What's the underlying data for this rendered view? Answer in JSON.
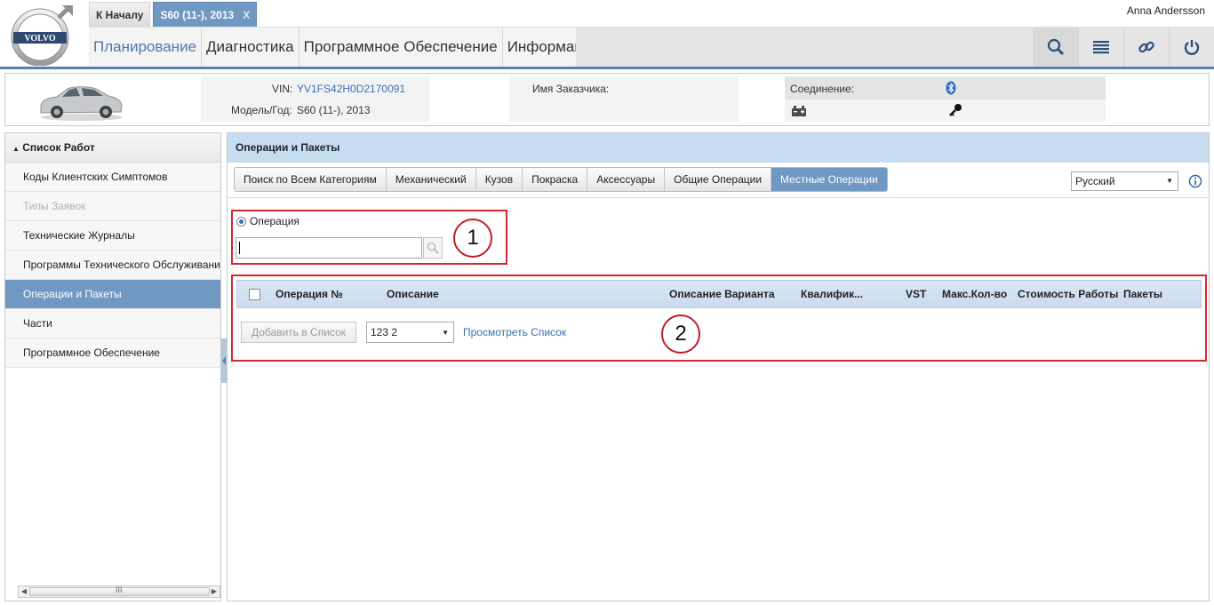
{
  "header": {
    "logo_text": "VOLVO",
    "user": "Anna Andersson",
    "tabs": [
      {
        "label": "К Началу"
      },
      {
        "label": "S60 (11-), 2013",
        "close": "X"
      }
    ],
    "nav": [
      {
        "label": "Планирование"
      },
      {
        "label": "Диагностика"
      },
      {
        "label": "Программное Обеспечение"
      },
      {
        "label": "Информация"
      }
    ],
    "icons": [
      "search-icon",
      "list-icon",
      "link-icon",
      "power-icon"
    ]
  },
  "vehicle": {
    "vin_label": "VIN:",
    "vin_value": "YV1FS42H0D2170091",
    "model_label": "Модель/Год:",
    "model_value": "S60 (11-), 2013",
    "customer_label": "Имя Заказчика:",
    "connection_label": "Соединение:",
    "icons": [
      "bluetooth-icon",
      "battery-icon",
      "key-icon"
    ]
  },
  "sidebar": {
    "title": "Список Работ",
    "items": [
      {
        "label": "Коды Клиентских Симптомов"
      },
      {
        "label": "Типы Заявок"
      },
      {
        "label": "Технические Журналы"
      },
      {
        "label": "Программы Технического Обслуживания"
      },
      {
        "label": "Операции и Пакеты"
      },
      {
        "label": "Части"
      },
      {
        "label": "Программное Обеспечение"
      }
    ],
    "scroll_grip": "III"
  },
  "main": {
    "title": "Операции и Пакеты",
    "categories": [
      {
        "label": "Поиск по Всем Категориям"
      },
      {
        "label": "Механический"
      },
      {
        "label": "Кузов"
      },
      {
        "label": "Покраска"
      },
      {
        "label": "Аксессуары"
      },
      {
        "label": "Общие Операции"
      },
      {
        "label": "Местные Операции"
      }
    ],
    "language": "Русский",
    "search_option": "Операция",
    "search_value": "",
    "annotation_1": "1",
    "annotation_2": "2",
    "columns": [
      "Операция №",
      "Описание",
      "Описание Варианта",
      "Квалифик...",
      "VST",
      "Макс.Кол-во",
      "Стоимость Работы",
      "Пакеты"
    ],
    "add_button": "Добавить в Список",
    "list_select": "123 2",
    "view_link": "Просмотреть Список"
  },
  "colors": {
    "accent": "#6f98c3",
    "header_band": "#c6dcf0",
    "annotation_red": "#d9262e",
    "link": "#3a6fb0"
  }
}
